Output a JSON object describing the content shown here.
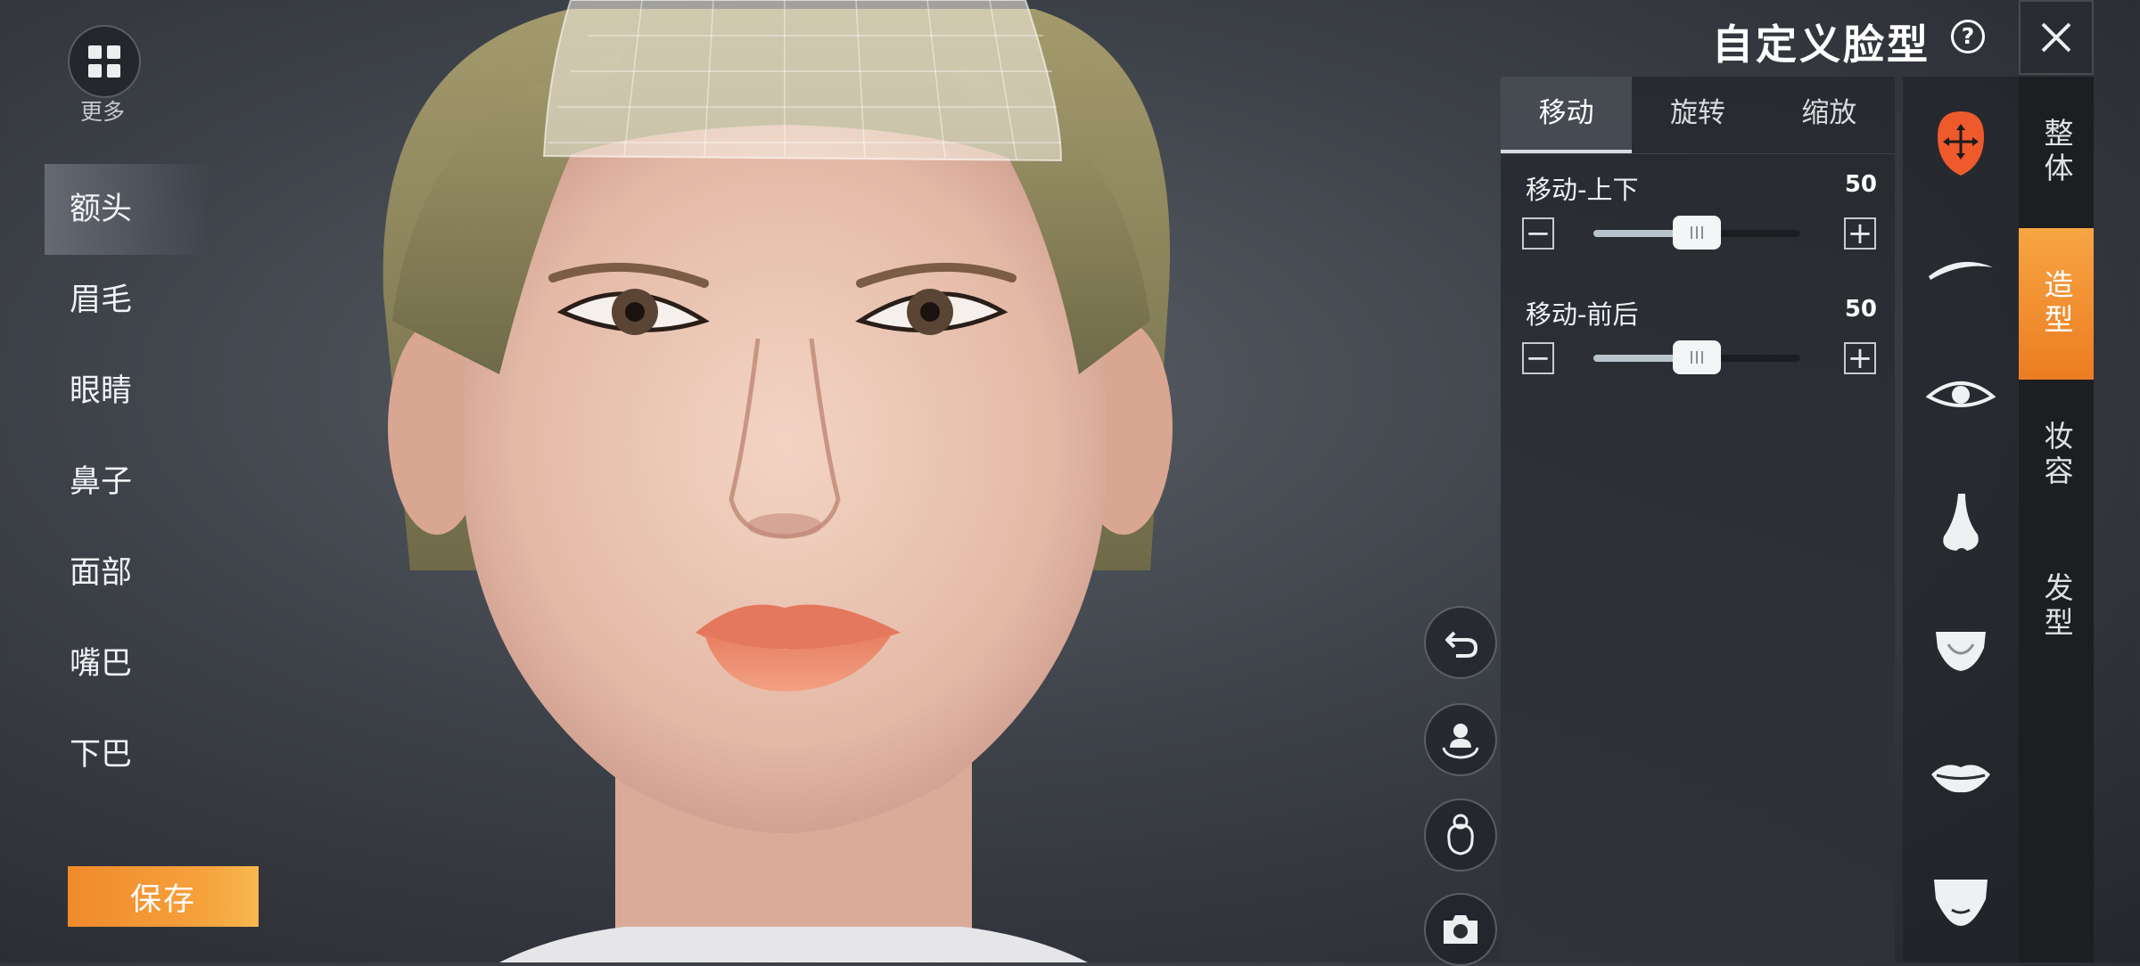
{
  "header": {
    "title": "自定义脸型",
    "help_glyph": "?"
  },
  "more": {
    "label": "更多"
  },
  "categories": [
    {
      "label": "额头",
      "active": true
    },
    {
      "label": "眉毛",
      "active": false
    },
    {
      "label": "眼睛",
      "active": false
    },
    {
      "label": "鼻子",
      "active": false
    },
    {
      "label": "面部",
      "active": false
    },
    {
      "label": "嘴巴",
      "active": false
    },
    {
      "label": "下巴",
      "active": false
    }
  ],
  "save": {
    "label": "保存"
  },
  "adjust": {
    "tabs": [
      {
        "label": "移动",
        "active": true
      },
      {
        "label": "旋转",
        "active": false
      },
      {
        "label": "缩放",
        "active": false
      }
    ],
    "sliders": [
      {
        "label": "移动-上下",
        "value": 50,
        "fraction": 0.5
      },
      {
        "label": "移动-前后",
        "value": 50,
        "fraction": 0.5
      }
    ]
  },
  "feature_icons": [
    {
      "name": "forehead-move-icon",
      "active": true
    },
    {
      "name": "eyebrow-icon"
    },
    {
      "name": "eye-icon"
    },
    {
      "name": "nose-icon"
    },
    {
      "name": "face-icon"
    },
    {
      "name": "mouth-icon"
    },
    {
      "name": "chin-icon"
    }
  ],
  "right_tabs": [
    {
      "label": "整体",
      "active": false
    },
    {
      "label": "造型",
      "active": true
    },
    {
      "label": "妆容",
      "active": false
    },
    {
      "label": "发型",
      "active": false
    }
  ],
  "tools": [
    {
      "name": "undo-icon"
    },
    {
      "name": "rotate-view-icon"
    },
    {
      "name": "hair-toggle-icon"
    },
    {
      "name": "camera-icon"
    }
  ],
  "colors": {
    "accent": "#f08a2a",
    "active_feature": "#ee5a2c"
  }
}
